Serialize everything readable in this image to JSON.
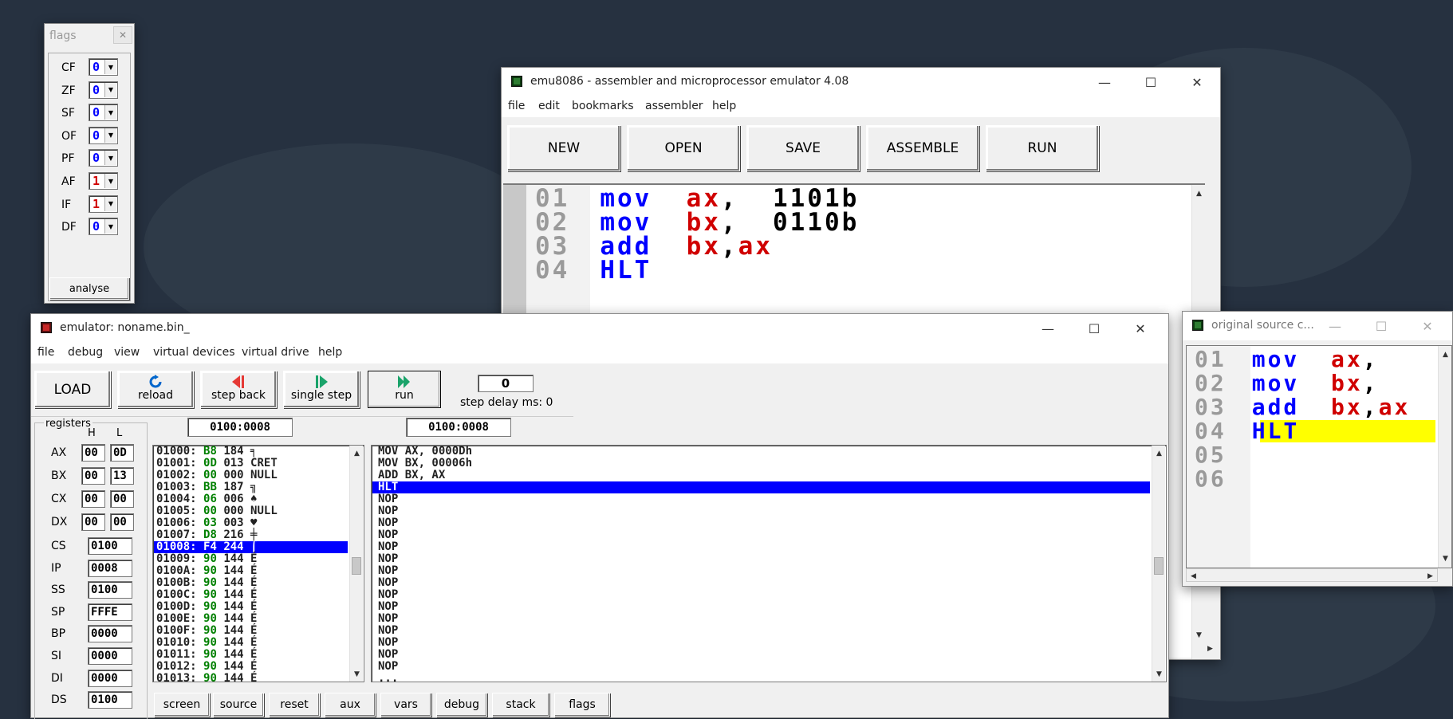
{
  "flags_window": {
    "title": "flags",
    "flags": [
      {
        "name": "CF",
        "value": "0"
      },
      {
        "name": "ZF",
        "value": "0"
      },
      {
        "name": "SF",
        "value": "0"
      },
      {
        "name": "OF",
        "value": "0"
      },
      {
        "name": "PF",
        "value": "0"
      },
      {
        "name": "AF",
        "value": "1"
      },
      {
        "name": "IF",
        "value": "1"
      },
      {
        "name": "DF",
        "value": "0"
      }
    ],
    "analyse_label": "analyse"
  },
  "main_window": {
    "title": "emu8086 - assembler and microprocessor emulator 4.08",
    "menu": [
      "file",
      "edit",
      "bookmarks",
      "assembler",
      "help"
    ],
    "buttons": [
      "NEW",
      "OPEN",
      "SAVE",
      "ASSEMBLE",
      "RUN"
    ],
    "code": [
      {
        "ln": "01",
        "tokens": [
          {
            "t": "mov",
            "c": "kw"
          },
          {
            "t": "  ax",
            "c": "reg"
          },
          {
            "t": ",  1101b",
            "c": "num"
          }
        ]
      },
      {
        "ln": "02",
        "tokens": [
          {
            "t": "mov",
            "c": "kw"
          },
          {
            "t": "  bx",
            "c": "reg"
          },
          {
            "t": ",  0110b",
            "c": "num"
          }
        ]
      },
      {
        "ln": "03",
        "tokens": [
          {
            "t": "add",
            "c": "kw"
          },
          {
            "t": "  bx",
            "c": "reg"
          },
          {
            "t": ",",
            "c": "num"
          },
          {
            "t": "ax",
            "c": "reg"
          }
        ]
      },
      {
        "ln": "04",
        "tokens": [
          {
            "t": "HLT",
            "c": "kw"
          }
        ]
      }
    ]
  },
  "source_window": {
    "title": "original source c...",
    "lines": [
      {
        "ln": "01",
        "tokens": [
          {
            "t": "mov",
            "c": "kw"
          },
          {
            "t": "  ax",
            "c": "reg"
          },
          {
            "t": ",",
            "c": "num"
          }
        ]
      },
      {
        "ln": "02",
        "tokens": [
          {
            "t": "mov",
            "c": "kw"
          },
          {
            "t": "  bx",
            "c": "reg"
          },
          {
            "t": ", ",
            "c": "num"
          }
        ]
      },
      {
        "ln": "03",
        "tokens": [
          {
            "t": "add",
            "c": "kw"
          },
          {
            "t": "  bx",
            "c": "reg"
          },
          {
            "t": ",",
            "c": "num"
          },
          {
            "t": "ax",
            "c": "reg"
          }
        ]
      },
      {
        "ln": "04",
        "tokens": [
          {
            "t": "HLT",
            "c": "kw"
          }
        ]
      },
      {
        "ln": "05",
        "tokens": []
      },
      {
        "ln": "06",
        "tokens": []
      }
    ],
    "highlight_line": 3
  },
  "emulator_window": {
    "title": "emulator: noname.bin_",
    "menu": [
      "file",
      "debug",
      "view",
      "virtual devices",
      "virtual drive",
      "help"
    ],
    "toolbar": {
      "load": "LOAD",
      "reload": "reload",
      "step_back": "step back",
      "single_step": "single step",
      "run": "run",
      "step_delay_value": "0",
      "step_delay_label": "step delay ms: 0"
    },
    "registers": {
      "group_label": "registers",
      "h_header": "H",
      "l_header": "L",
      "general": [
        {
          "name": "AX",
          "h": "00",
          "l": "0D"
        },
        {
          "name": "BX",
          "h": "00",
          "l": "13"
        },
        {
          "name": "CX",
          "h": "00",
          "l": "00"
        },
        {
          "name": "DX",
          "h": "00",
          "l": "00"
        }
      ],
      "other": [
        {
          "name": "CS",
          "value": "0100"
        },
        {
          "name": "IP",
          "value": "0008"
        },
        {
          "name": "SS",
          "value": "0100"
        },
        {
          "name": "SP",
          "value": "FFFE"
        },
        {
          "name": "BP",
          "value": "0000"
        },
        {
          "name": "SI",
          "value": "0000"
        },
        {
          "name": "DI",
          "value": "0000"
        },
        {
          "name": "DS",
          "value": "0100"
        }
      ]
    },
    "memory_address": "0100:0008",
    "disasm_address": "0100:0008",
    "memory": [
      {
        "addr": "01000:",
        "hex": "B8",
        "dec": "184",
        "ch": "╕",
        "sel": false
      },
      {
        "addr": "01001:",
        "hex": "0D",
        "dec": "013",
        "ch": "CRET",
        "sel": false
      },
      {
        "addr": "01002:",
        "hex": "00",
        "dec": "000",
        "ch": "NULL",
        "sel": false
      },
      {
        "addr": "01003:",
        "hex": "BB",
        "dec": "187",
        "ch": "╗",
        "sel": false
      },
      {
        "addr": "01004:",
        "hex": "06",
        "dec": "006",
        "ch": "♠",
        "sel": false
      },
      {
        "addr": "01005:",
        "hex": "00",
        "dec": "000",
        "ch": "NULL",
        "sel": false
      },
      {
        "addr": "01006:",
        "hex": "03",
        "dec": "003",
        "ch": "♥",
        "sel": false
      },
      {
        "addr": "01007:",
        "hex": "D8",
        "dec": "216",
        "ch": "╪",
        "sel": false
      },
      {
        "addr": "01008:",
        "hex": "F4",
        "dec": "244",
        "ch": "⌠",
        "sel": true
      },
      {
        "addr": "01009:",
        "hex": "90",
        "dec": "144",
        "ch": "É",
        "sel": false
      },
      {
        "addr": "0100A:",
        "hex": "90",
        "dec": "144",
        "ch": "É",
        "sel": false
      },
      {
        "addr": "0100B:",
        "hex": "90",
        "dec": "144",
        "ch": "É",
        "sel": false
      },
      {
        "addr": "0100C:",
        "hex": "90",
        "dec": "144",
        "ch": "É",
        "sel": false
      },
      {
        "addr": "0100D:",
        "hex": "90",
        "dec": "144",
        "ch": "É",
        "sel": false
      },
      {
        "addr": "0100E:",
        "hex": "90",
        "dec": "144",
        "ch": "É",
        "sel": false
      },
      {
        "addr": "0100F:",
        "hex": "90",
        "dec": "144",
        "ch": "É",
        "sel": false
      },
      {
        "addr": "01010:",
        "hex": "90",
        "dec": "144",
        "ch": "É",
        "sel": false
      },
      {
        "addr": "01011:",
        "hex": "90",
        "dec": "144",
        "ch": "É",
        "sel": false
      },
      {
        "addr": "01012:",
        "hex": "90",
        "dec": "144",
        "ch": "É",
        "sel": false
      },
      {
        "addr": "01013:",
        "hex": "90",
        "dec": "144",
        "ch": "É",
        "sel": false
      }
    ],
    "disasm": [
      {
        "text": "MOV AX, 0000Dh",
        "sel": false
      },
      {
        "text": "MOV BX, 00006h",
        "sel": false
      },
      {
        "text": "ADD BX, AX",
        "sel": false
      },
      {
        "text": "HLT",
        "sel": true
      },
      {
        "text": "NOP",
        "sel": false
      },
      {
        "text": "NOP",
        "sel": false
      },
      {
        "text": "NOP",
        "sel": false
      },
      {
        "text": "NOP",
        "sel": false
      },
      {
        "text": "NOP",
        "sel": false
      },
      {
        "text": "NOP",
        "sel": false
      },
      {
        "text": "NOP",
        "sel": false
      },
      {
        "text": "NOP",
        "sel": false
      },
      {
        "text": "NOP",
        "sel": false
      },
      {
        "text": "NOP",
        "sel": false
      },
      {
        "text": "NOP",
        "sel": false
      },
      {
        "text": "NOP",
        "sel": false
      },
      {
        "text": "NOP",
        "sel": false
      },
      {
        "text": "NOP",
        "sel": false
      },
      {
        "text": "NOP",
        "sel": false
      },
      {
        "text": "...",
        "sel": false
      }
    ],
    "bottom_buttons": [
      "screen",
      "source",
      "reset",
      "aux",
      "vars",
      "debug",
      "stack",
      "flags"
    ]
  }
}
